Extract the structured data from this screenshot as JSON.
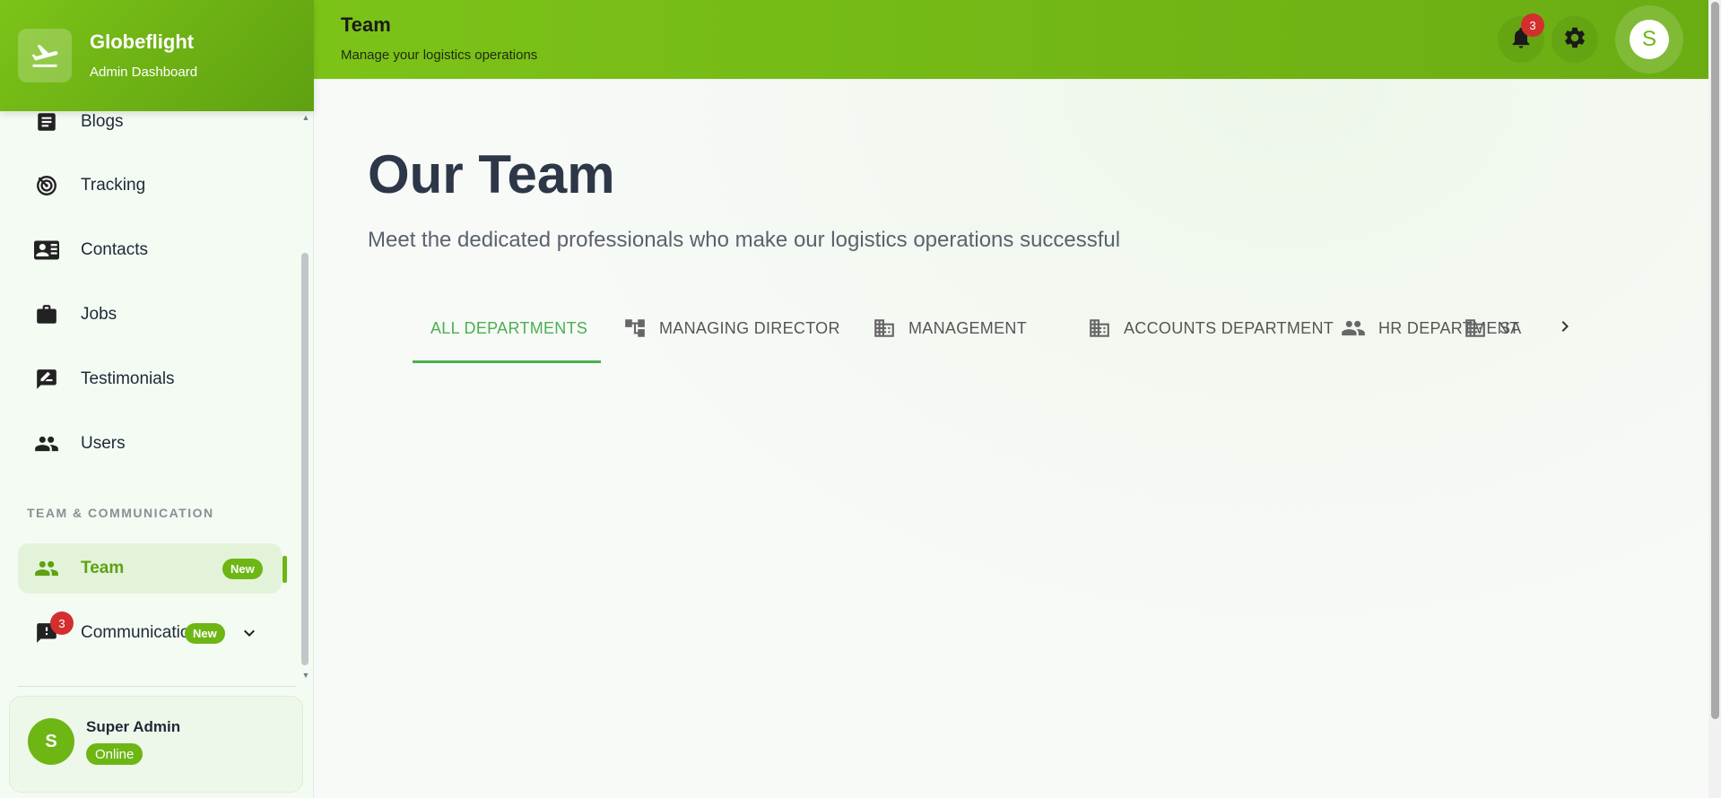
{
  "brand": {
    "title": "Globeflight",
    "subtitle": "Admin Dashboard"
  },
  "sidebar": {
    "items": [
      {
        "label": "Blogs",
        "icon": "article-icon"
      },
      {
        "label": "Tracking",
        "icon": "tracking-icon"
      },
      {
        "label": "Contacts",
        "icon": "contact-card-icon"
      },
      {
        "label": "Jobs",
        "icon": "briefcase-icon"
      },
      {
        "label": "Testimonials",
        "icon": "rate-review-icon"
      },
      {
        "label": "Users",
        "icon": "people-icon"
      }
    ],
    "section_title": "TEAM & COMMUNICATION",
    "team": {
      "label": "Team",
      "badge": "New"
    },
    "communication": {
      "label": "Communications",
      "badge": "New",
      "count": "3"
    }
  },
  "user": {
    "initial": "S",
    "name": "Super Admin",
    "status": "Online"
  },
  "topbar": {
    "title": "Team",
    "subtitle": "Manage your logistics operations",
    "notification_count": "3",
    "avatar_initial": "S"
  },
  "main": {
    "title": "Our Team",
    "subtitle": "Meet the dedicated professionals who make our logistics operations successful",
    "tabs": [
      {
        "label": "ALL DEPARTMENTS"
      },
      {
        "label": "MANAGING DIRECTOR"
      },
      {
        "label": "MANAGEMENT"
      },
      {
        "label": "ACCOUNTS DEPARTMENT"
      },
      {
        "label": "HR DEPARTMENT"
      },
      {
        "label": "SA"
      }
    ]
  },
  "colors": {
    "accent": "#6db614",
    "active_tab": "#4caf50",
    "badge_red": "#d32f2f"
  }
}
